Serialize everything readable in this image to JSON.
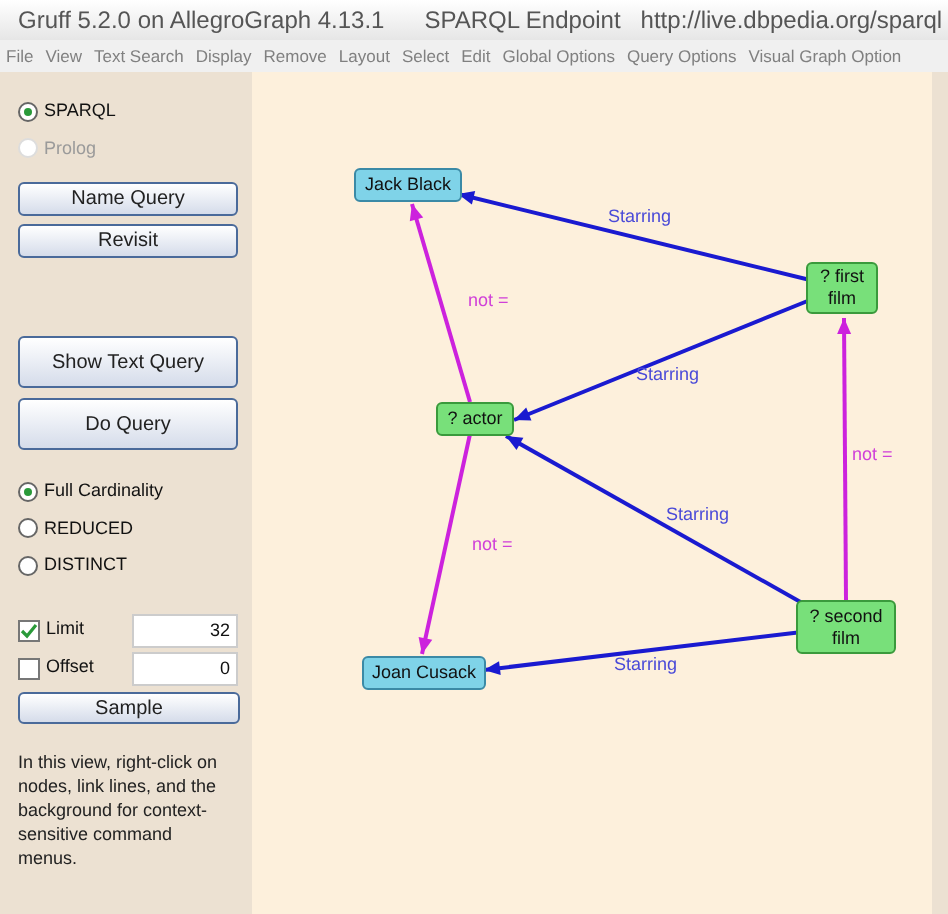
{
  "window": {
    "title": "Gruff 5.2.0 on AllegroGraph 4.13.1",
    "subtitle": "SPARQL Endpoint",
    "url": "http://live.dbpedia.org/sparql"
  },
  "menu": [
    "File",
    "View",
    "Text Search",
    "Display",
    "Remove",
    "Layout",
    "Select",
    "Edit",
    "Global Options",
    "Query Options",
    "Visual Graph Option"
  ],
  "language": [
    {
      "label": "SPARQL",
      "selected": true,
      "disabled": false
    },
    {
      "label": "Prolog",
      "selected": false,
      "disabled": true
    }
  ],
  "buttons_top": [
    "Name Query",
    "Revisit"
  ],
  "buttons_query": [
    "Show Text Query",
    "Do Query"
  ],
  "cardinality": [
    {
      "label": "Full Cardinality",
      "selected": true
    },
    {
      "label": "REDUCED",
      "selected": false
    },
    {
      "label": "DISTINCT",
      "selected": false
    }
  ],
  "limits": [
    {
      "label": "Limit",
      "checked": true,
      "value": "32"
    },
    {
      "label": "Offset",
      "checked": false,
      "value": "0"
    }
  ],
  "sample_button": "Sample",
  "help_text": "In this view, right-click on nodes, link lines, and the background for context-sensitive command menus.",
  "graph": {
    "nodes": [
      {
        "label": "Jack Black",
        "kind": "resource"
      },
      {
        "label": "? first film",
        "kind": "variable"
      },
      {
        "label": "? actor",
        "kind": "variable"
      },
      {
        "label": "? second film",
        "kind": "variable"
      },
      {
        "label": "Joan Cusack",
        "kind": "resource"
      }
    ],
    "edges": [
      {
        "label": "Starring",
        "kind": "relation"
      },
      {
        "label": "Starring",
        "kind": "relation"
      },
      {
        "label": "not =",
        "kind": "inequality"
      },
      {
        "label": "Starring",
        "kind": "relation"
      },
      {
        "label": "not =",
        "kind": "inequality"
      },
      {
        "label": "not =",
        "kind": "inequality"
      },
      {
        "label": "Starring",
        "kind": "relation"
      }
    ]
  }
}
